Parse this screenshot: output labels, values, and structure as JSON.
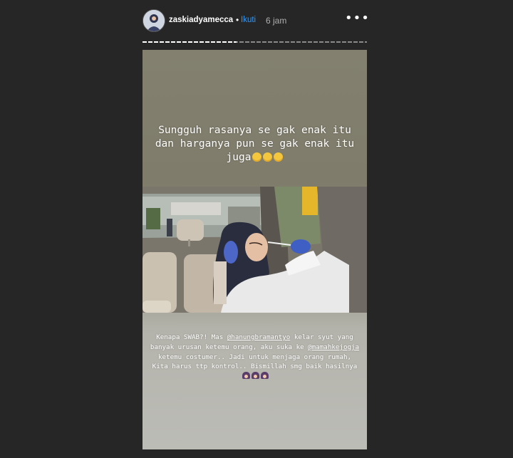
{
  "header": {
    "username": "zaskiadyamecca",
    "dot": "•",
    "follow_label": "Ikuti",
    "time": "6 jam",
    "more": "•••"
  },
  "story": {
    "progress_fraction": 0.42,
    "caption_top": {
      "text": "Sungguh rasanya se gak enak itu dan harganya pun se gak enak itu juga",
      "emoji": "grinning-sweat-emoji"
    },
    "caption_bottom": {
      "part1": "Kenapa SWAB?! Mas ",
      "mention1": "@hanungbramantyo",
      "part2": " kelar syut yang banyak urusan ketemu orang, aku suka ke ",
      "mention2": "@mamahkejogja",
      "part3": " ketemu costumer.. Jadi untuk menjaga orang rumah, Kita harus ttp kontrol.. Bismillah smg baik hasilnya",
      "emoji": "girl-emoji"
    }
  },
  "colors": {
    "background": "#262626",
    "follow": "#3897f0",
    "story_top": "#83806f",
    "story_bottom": "#bcbcb7"
  }
}
